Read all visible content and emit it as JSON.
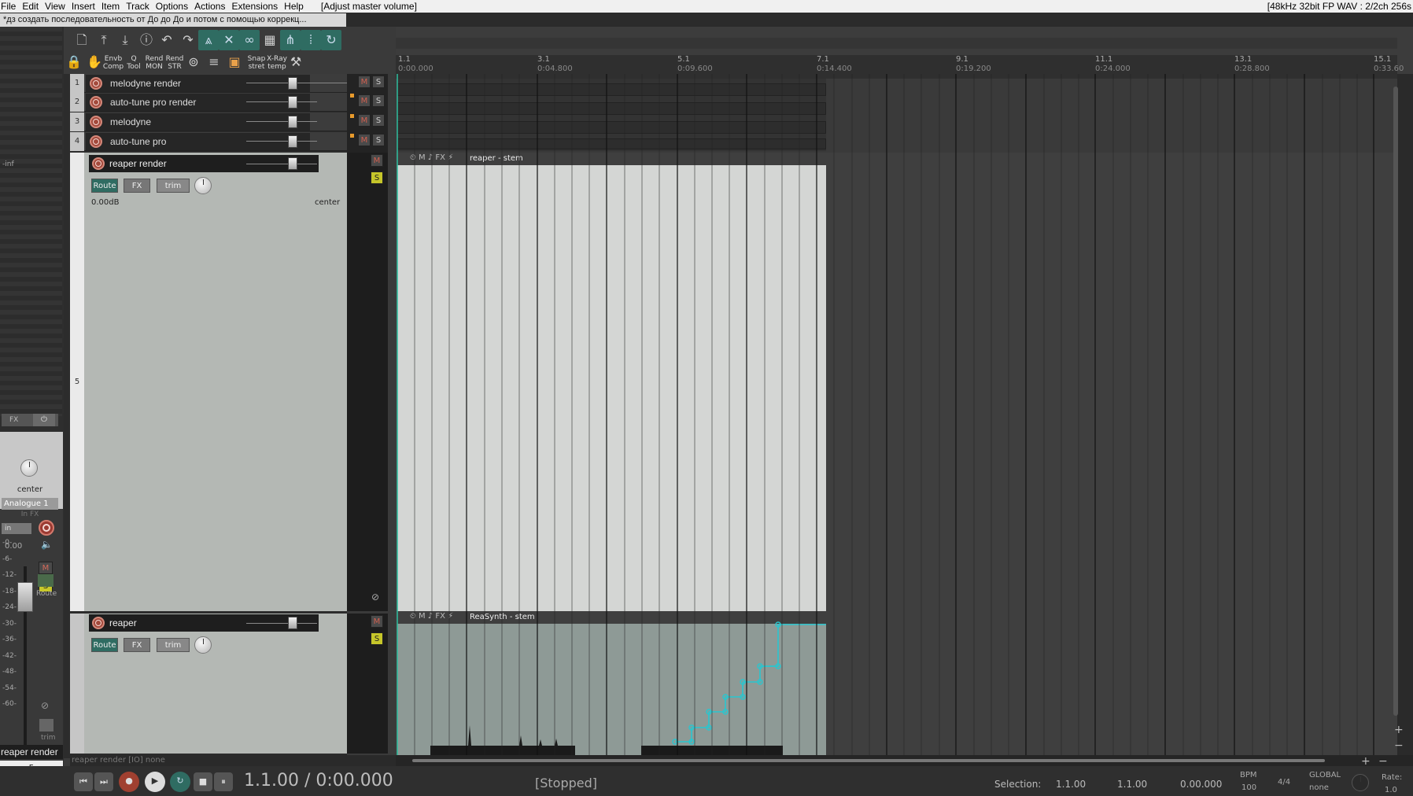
{
  "menu": {
    "items": [
      "File",
      "Edit",
      "View",
      "Insert",
      "Item",
      "Track",
      "Options",
      "Actions",
      "Extensions",
      "Help"
    ],
    "hint": "[Adjust master volume]",
    "format": "[48kHz 32bit FP WAV : 2/2ch 256s"
  },
  "project_tab": "*дз создать последовательность от До до До и потом с помощью коррекц...",
  "toolbar": {
    "labels": {
      "envb": "Envb\nComp",
      "qtool": "Q\nTool",
      "rend_mon": "Rend\nMON",
      "rend_str": "Rend\nSTR",
      "snap": "Snap\nstret",
      "xray": "X-Ray\ntemp"
    }
  },
  "tracks": [
    {
      "num": "1",
      "name": "melodyne render"
    },
    {
      "num": "2",
      "name": "auto-tune pro render"
    },
    {
      "num": "3",
      "name": "melodyne"
    },
    {
      "num": "4",
      "name": "auto-tune pro"
    },
    {
      "num": "5",
      "name": "reaper render",
      "volume": "0.00dB",
      "pan": "center",
      "route": "Route",
      "fx": "FX",
      "trim": "trim"
    },
    {
      "num": "",
      "name": "reaper",
      "route": "Route",
      "fx": "FX",
      "trim": "trim"
    }
  ],
  "track5_num": "5",
  "ms": {
    "m": "M",
    "s": "S"
  },
  "ruler": [
    {
      "bar": "1.1",
      "time": "0:00.000"
    },
    {
      "bar": "3.1",
      "time": "0:04.800"
    },
    {
      "bar": "5.1",
      "time": "0:09.600"
    },
    {
      "bar": "7.1",
      "time": "0:14.400"
    },
    {
      "bar": "9.1",
      "time": "0:19.200"
    },
    {
      "bar": "11.1",
      "time": "0:24.000"
    },
    {
      "bar": "13.1",
      "time": "0:28.800"
    },
    {
      "bar": "15.1",
      "time": "0:33.60"
    }
  ],
  "items": {
    "reaper_stem": "reaper - stem",
    "reasynth_stem": "ReaSynth - stem"
  },
  "mixer": {
    "fx": "FX",
    "pan": "center",
    "input": "Analogue 1",
    "infx": "In FX",
    "in": "in",
    "volume": "0.00",
    "scale": [
      "-inf",
      "-0-",
      "-6-",
      "-12-",
      "-18-",
      "-24-",
      "-30-",
      "-36-",
      "-42-",
      "-48-",
      "-54-",
      "-60-"
    ],
    "route": "Route",
    "trim": "trim",
    "track_name": "reaper render",
    "track_num": "5"
  },
  "status_line": "reaper render [IO] none",
  "transport": {
    "position": "1.1.00 / 0:00.000",
    "state": "[Stopped]",
    "selection_label": "Selection:",
    "sel_start": "1.1.00",
    "sel_end": "1.1.00",
    "sel_len": "0.00.000",
    "bpm_label": "BPM",
    "bpm": "100",
    "timesig": "4/4",
    "global": "GLOBAL",
    "global_val": "none",
    "rate_label": "Rate:",
    "rate": "1.0"
  },
  "colors": {
    "accent": "#2f6c62",
    "automation": "#29c6cf",
    "solo": "#c6c62a",
    "record": "#a34a3c"
  }
}
